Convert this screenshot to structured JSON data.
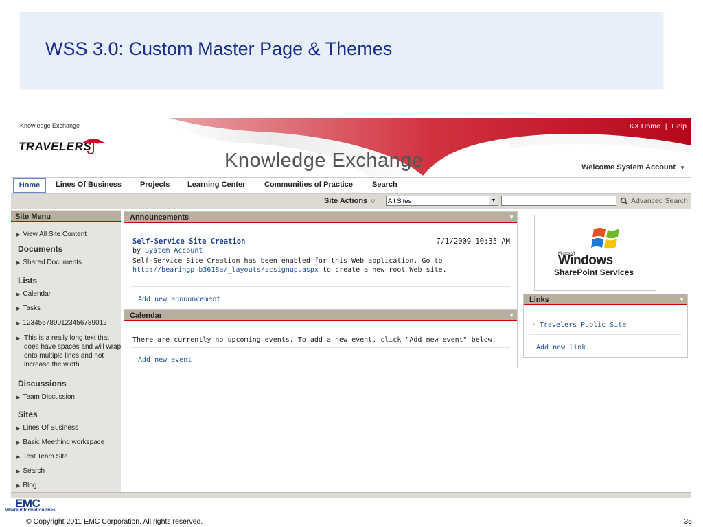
{
  "slide": {
    "title": "WSS 3.0: Custom Master Page & Themes",
    "copyright": "© Copyright 2011 EMC Corporation. All rights reserved.",
    "page_number": "35",
    "logo_text": "EMC",
    "logo_tagline": "where information lives"
  },
  "header": {
    "site_name": "Knowledge Exchange",
    "logo_text": "TRAVELERS",
    "top_link_home": "KX Home",
    "top_link_separator": "|",
    "top_link_help": "Help",
    "title": "Knowledge Exchange",
    "welcome": "Welcome System Account",
    "brand_red": "#c8102e"
  },
  "nav": {
    "tabs": [
      {
        "label": "Home"
      },
      {
        "label": "Lines Of Business"
      },
      {
        "label": "Projects"
      },
      {
        "label": "Learning Center"
      },
      {
        "label": "Communities of Practice"
      },
      {
        "label": "Search"
      }
    ]
  },
  "actions": {
    "site_actions": "Site Actions",
    "scope": "All Sites",
    "search_value": "",
    "advanced_search": "Advanced Search"
  },
  "left_nav": {
    "title": "Site Menu",
    "view_all": "View All Site Content",
    "sections": [
      {
        "heading": "Documents",
        "items": [
          "Shared Documents"
        ]
      },
      {
        "heading": "Lists",
        "items": [
          "Calendar",
          "Tasks",
          "1234567890123456789012",
          "This is a really long text that does have spaces and will wrap onto multiple lines and not increase the width"
        ]
      },
      {
        "heading": "Discussions",
        "items": [
          "Team Discussion"
        ]
      },
      {
        "heading": "Sites",
        "items": [
          "Lines Of Business",
          "Basic Meething workspace",
          "Test Team Site",
          "Search",
          "Blog"
        ]
      }
    ]
  },
  "announcements": {
    "title": "Announcements",
    "item_title": "Self-Service Site Creation",
    "item_date": "7/1/2009 10:35 AM",
    "by_prefix": "by",
    "author": "System Account",
    "body_before": "Self-Service Site Creation has been enabled for this Web application. Go to",
    "body_link": "http://bearingp-b3618a/_layouts/scsignup.aspx",
    "body_after": "to create a new root Web site.",
    "add_link": "Add new announcement"
  },
  "calendar": {
    "title": "Calendar",
    "empty_text": "There are currently no upcoming events. To add a new event, click \"Add new event\" below.",
    "add_link": "Add new event"
  },
  "windows_logo": {
    "small": "Microsoft",
    "big": "Windows",
    "sub": "SharePoint Services"
  },
  "links": {
    "title": "Links",
    "items": [
      "Travelers Public Site"
    ],
    "add_link": "Add new link"
  }
}
